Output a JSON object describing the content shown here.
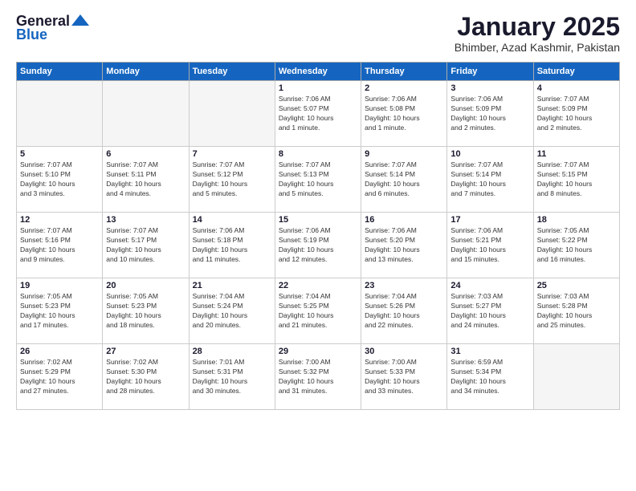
{
  "logo": {
    "line1": "General",
    "line2": "Blue"
  },
  "title": "January 2025",
  "subtitle": "Bhimber, Azad Kashmir, Pakistan",
  "days_header": [
    "Sunday",
    "Monday",
    "Tuesday",
    "Wednesday",
    "Thursday",
    "Friday",
    "Saturday"
  ],
  "weeks": [
    [
      {
        "day": "",
        "info": ""
      },
      {
        "day": "",
        "info": ""
      },
      {
        "day": "",
        "info": ""
      },
      {
        "day": "1",
        "info": "Sunrise: 7:06 AM\nSunset: 5:07 PM\nDaylight: 10 hours\nand 1 minute."
      },
      {
        "day": "2",
        "info": "Sunrise: 7:06 AM\nSunset: 5:08 PM\nDaylight: 10 hours\nand 1 minute."
      },
      {
        "day": "3",
        "info": "Sunrise: 7:06 AM\nSunset: 5:09 PM\nDaylight: 10 hours\nand 2 minutes."
      },
      {
        "day": "4",
        "info": "Sunrise: 7:07 AM\nSunset: 5:09 PM\nDaylight: 10 hours\nand 2 minutes."
      }
    ],
    [
      {
        "day": "5",
        "info": "Sunrise: 7:07 AM\nSunset: 5:10 PM\nDaylight: 10 hours\nand 3 minutes."
      },
      {
        "day": "6",
        "info": "Sunrise: 7:07 AM\nSunset: 5:11 PM\nDaylight: 10 hours\nand 4 minutes."
      },
      {
        "day": "7",
        "info": "Sunrise: 7:07 AM\nSunset: 5:12 PM\nDaylight: 10 hours\nand 5 minutes."
      },
      {
        "day": "8",
        "info": "Sunrise: 7:07 AM\nSunset: 5:13 PM\nDaylight: 10 hours\nand 5 minutes."
      },
      {
        "day": "9",
        "info": "Sunrise: 7:07 AM\nSunset: 5:14 PM\nDaylight: 10 hours\nand 6 minutes."
      },
      {
        "day": "10",
        "info": "Sunrise: 7:07 AM\nSunset: 5:14 PM\nDaylight: 10 hours\nand 7 minutes."
      },
      {
        "day": "11",
        "info": "Sunrise: 7:07 AM\nSunset: 5:15 PM\nDaylight: 10 hours\nand 8 minutes."
      }
    ],
    [
      {
        "day": "12",
        "info": "Sunrise: 7:07 AM\nSunset: 5:16 PM\nDaylight: 10 hours\nand 9 minutes."
      },
      {
        "day": "13",
        "info": "Sunrise: 7:07 AM\nSunset: 5:17 PM\nDaylight: 10 hours\nand 10 minutes."
      },
      {
        "day": "14",
        "info": "Sunrise: 7:06 AM\nSunset: 5:18 PM\nDaylight: 10 hours\nand 11 minutes."
      },
      {
        "day": "15",
        "info": "Sunrise: 7:06 AM\nSunset: 5:19 PM\nDaylight: 10 hours\nand 12 minutes."
      },
      {
        "day": "16",
        "info": "Sunrise: 7:06 AM\nSunset: 5:20 PM\nDaylight: 10 hours\nand 13 minutes."
      },
      {
        "day": "17",
        "info": "Sunrise: 7:06 AM\nSunset: 5:21 PM\nDaylight: 10 hours\nand 15 minutes."
      },
      {
        "day": "18",
        "info": "Sunrise: 7:05 AM\nSunset: 5:22 PM\nDaylight: 10 hours\nand 16 minutes."
      }
    ],
    [
      {
        "day": "19",
        "info": "Sunrise: 7:05 AM\nSunset: 5:23 PM\nDaylight: 10 hours\nand 17 minutes."
      },
      {
        "day": "20",
        "info": "Sunrise: 7:05 AM\nSunset: 5:23 PM\nDaylight: 10 hours\nand 18 minutes."
      },
      {
        "day": "21",
        "info": "Sunrise: 7:04 AM\nSunset: 5:24 PM\nDaylight: 10 hours\nand 20 minutes."
      },
      {
        "day": "22",
        "info": "Sunrise: 7:04 AM\nSunset: 5:25 PM\nDaylight: 10 hours\nand 21 minutes."
      },
      {
        "day": "23",
        "info": "Sunrise: 7:04 AM\nSunset: 5:26 PM\nDaylight: 10 hours\nand 22 minutes."
      },
      {
        "day": "24",
        "info": "Sunrise: 7:03 AM\nSunset: 5:27 PM\nDaylight: 10 hours\nand 24 minutes."
      },
      {
        "day": "25",
        "info": "Sunrise: 7:03 AM\nSunset: 5:28 PM\nDaylight: 10 hours\nand 25 minutes."
      }
    ],
    [
      {
        "day": "26",
        "info": "Sunrise: 7:02 AM\nSunset: 5:29 PM\nDaylight: 10 hours\nand 27 minutes."
      },
      {
        "day": "27",
        "info": "Sunrise: 7:02 AM\nSunset: 5:30 PM\nDaylight: 10 hours\nand 28 minutes."
      },
      {
        "day": "28",
        "info": "Sunrise: 7:01 AM\nSunset: 5:31 PM\nDaylight: 10 hours\nand 30 minutes."
      },
      {
        "day": "29",
        "info": "Sunrise: 7:00 AM\nSunset: 5:32 PM\nDaylight: 10 hours\nand 31 minutes."
      },
      {
        "day": "30",
        "info": "Sunrise: 7:00 AM\nSunset: 5:33 PM\nDaylight: 10 hours\nand 33 minutes."
      },
      {
        "day": "31",
        "info": "Sunrise: 6:59 AM\nSunset: 5:34 PM\nDaylight: 10 hours\nand 34 minutes."
      },
      {
        "day": "",
        "info": ""
      }
    ]
  ]
}
